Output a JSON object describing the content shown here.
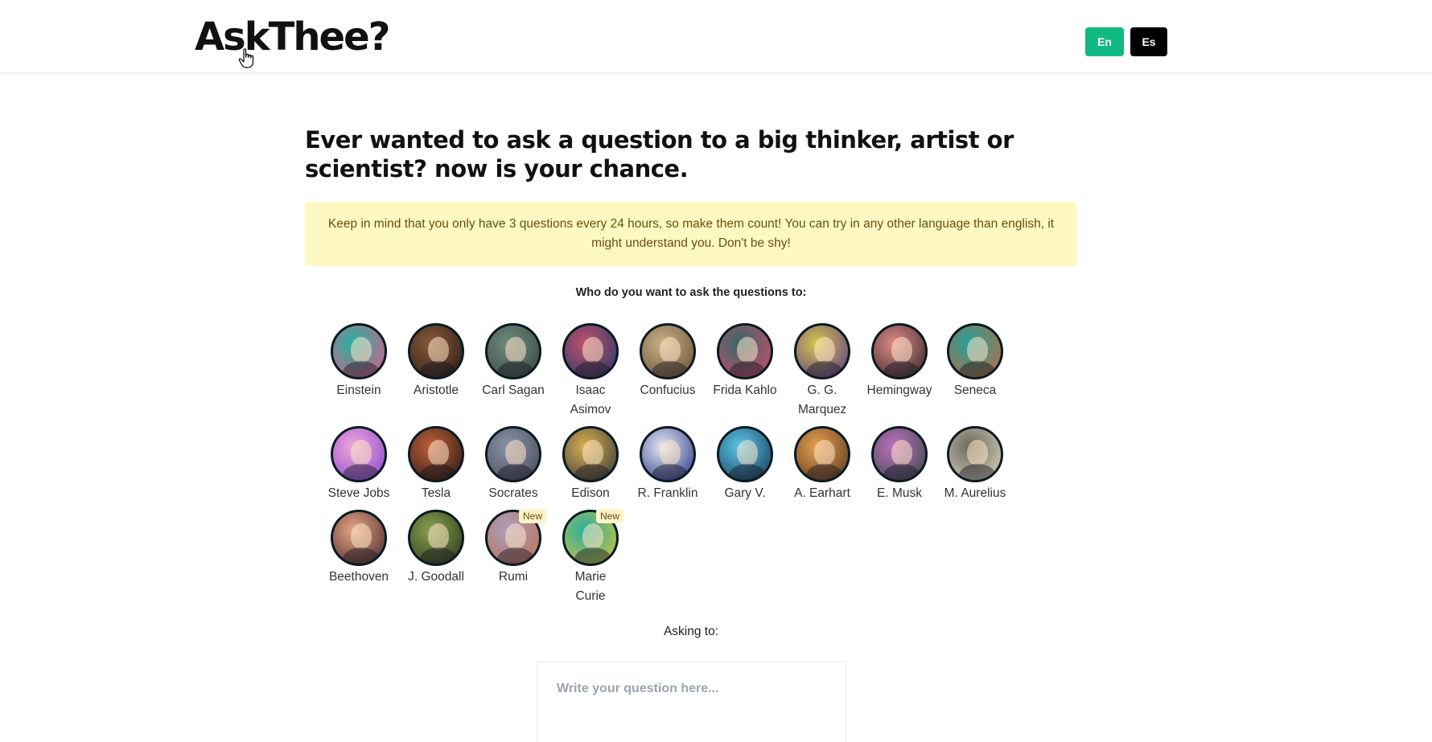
{
  "header": {
    "logo": "AskThee?",
    "lang_en": "En",
    "lang_es": "Es"
  },
  "main": {
    "headline": "Ever wanted to ask a question to a big thinker, artist or scientist? now is your chance.",
    "notice": "Keep in mind that you only have 3 questions every 24 hours, so make them count!  You can try in any other language than english, it might understand you. Don't be shy!",
    "prompt": "Who do you want to ask the questions to:",
    "asking_label": "Asking to:",
    "question_placeholder": "Write your question here..."
  },
  "people": [
    {
      "name": "Einstein",
      "colors": [
        "#1fb5a0",
        "#e05a8a"
      ]
    },
    {
      "name": "Aristotle",
      "colors": [
        "#8a5a3a",
        "#2a1d16"
      ]
    },
    {
      "name": "Carl Sagan",
      "colors": [
        "#6f8a7c",
        "#3a4a44"
      ]
    },
    {
      "name": "Isaac Asimov",
      "colors": [
        "#c0506a",
        "#2a3a6a"
      ]
    },
    {
      "name": "Confucius",
      "colors": [
        "#c9b08a",
        "#6a5436"
      ]
    },
    {
      "name": "Frida Kahlo",
      "colors": [
        "#2f6a6a",
        "#d44a6a"
      ]
    },
    {
      "name": "G. G. Marquez",
      "colors": [
        "#d8c84a",
        "#5a3a8a"
      ]
    },
    {
      "name": "Hemingway",
      "colors": [
        "#e08a8a",
        "#3a2a2a"
      ]
    },
    {
      "name": "Seneca",
      "colors": [
        "#1fa0a0",
        "#c06a3a"
      ]
    },
    {
      "name": "Steve Jobs",
      "colors": [
        "#f0a8d8",
        "#8a4ad0"
      ]
    },
    {
      "name": "Tesla",
      "colors": [
        "#c0603a",
        "#2a1a14"
      ]
    },
    {
      "name": "Socrates",
      "colors": [
        "#8a94a8",
        "#4a4a5a"
      ]
    },
    {
      "name": "Edison",
      "colors": [
        "#d8b050",
        "#3a3a3a"
      ]
    },
    {
      "name": "R. Franklin",
      "colors": [
        "#e8e8f0",
        "#2a3a8a"
      ]
    },
    {
      "name": "Gary V.",
      "colors": [
        "#5ac8e8",
        "#1a3a5a"
      ]
    },
    {
      "name": "A. Earhart",
      "colors": [
        "#e8a050",
        "#5a3a20"
      ]
    },
    {
      "name": "E. Musk",
      "colors": [
        "#c070c0",
        "#3a4a4a"
      ]
    },
    {
      "name": "M. Aurelius",
      "colors": [
        "#6a6a5a",
        "#d8d0c0"
      ]
    },
    {
      "name": "Beethoven",
      "colors": [
        "#e8a888",
        "#4a2a2a"
      ]
    },
    {
      "name": "J. Goodall",
      "colors": [
        "#8aa050",
        "#2a3a1a"
      ]
    },
    {
      "name": "Rumi",
      "colors": [
        "#a8a0c0",
        "#c07050"
      ],
      "badge": "New"
    },
    {
      "name": "Marie Curie",
      "colors": [
        "#2ab0a0",
        "#d0c040"
      ],
      "badge": "New"
    }
  ]
}
